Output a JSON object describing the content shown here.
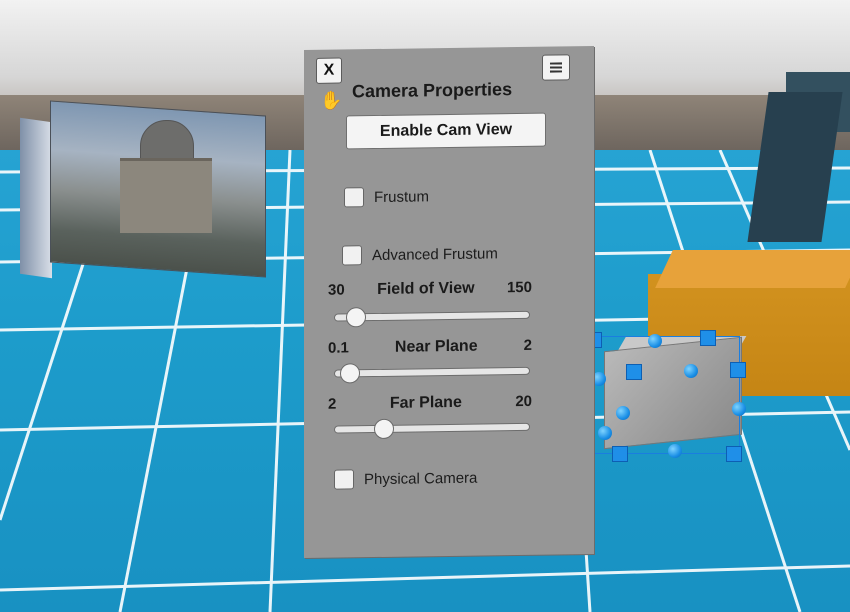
{
  "panel": {
    "close_label": "X",
    "menu_icon": "hamburger-menu-icon",
    "hand_icon": "hand-grab-icon",
    "title": "Camera Properties",
    "enable_cam_view_label": "Enable Cam View",
    "checkboxes": {
      "frustum": {
        "label": "Frustum",
        "checked": false
      },
      "advanced_frustum": {
        "label": "Advanced Frustum",
        "checked": false
      },
      "physical_camera": {
        "label": "Physical Camera",
        "checked": false
      }
    },
    "sliders": {
      "field_of_view": {
        "label": "Field of View",
        "min": "30",
        "max": "150",
        "value_fraction": 0.06
      },
      "near_plane": {
        "label": "Near Plane",
        "min": "0.1",
        "max": "2",
        "value_fraction": 0.03
      },
      "far_plane": {
        "label": "Far Plane",
        "min": "2",
        "max": "20",
        "value_fraction": 0.22
      }
    }
  },
  "colors": {
    "panel_bg": "#969696",
    "floor": "#1d9ccb",
    "gizmo": "#1f8fe8",
    "orange_block": "#d2921f"
  }
}
